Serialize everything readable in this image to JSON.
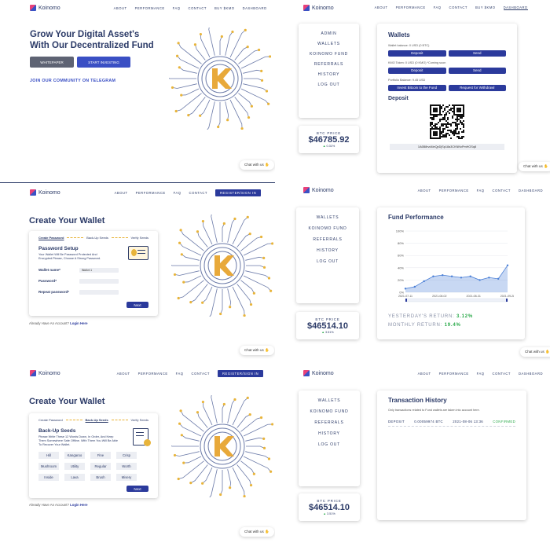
{
  "brand": {
    "name": "Koinomo"
  },
  "nav": {
    "about": "ABOUT",
    "performance": "PERFORMANCE",
    "faq": "FAQ",
    "contact": "CONTACT",
    "buy": "BUY $KMO",
    "dashboard": "DASHBOARD",
    "register": "REGISTER/SIGN IN"
  },
  "landing": {
    "headline_1": "Grow Your Digital Asset's",
    "headline_2": "With Our Decentralized Fund",
    "whitepaper": "WHITEPAPER",
    "start": "START INVESTING",
    "telegram": "JOIN OUR COMMUNITY ON TELEGRAM"
  },
  "menu": {
    "admin": "ADMIN",
    "wallets": "WALLETS",
    "fund": "KOINOMO FUND",
    "referrals": "REFERRALS",
    "history": "HISTORY",
    "logout": "LOG OUT"
  },
  "btc": {
    "label": "BTC PRICE",
    "price_1": "$46785.92",
    "change_1": "0.31%",
    "price_2": "$46514.10",
    "change_2": "3.51%",
    "price_3": "$46514.10",
    "change_3": "3.51%"
  },
  "wallets": {
    "title": "Wallets",
    "btc_balance": "Wallet balance: 0 USD (0 BTC)",
    "deposit": "Deposit",
    "send": "Send",
    "kmo_balance": "KMO Token: 0 USD (0 KMO) *Coming soon",
    "portfolio": "Portfolio Balance: 9.45 USD",
    "invest": "Invest Bitcoin to the Fund",
    "withdraw": "Request for Withdrawl",
    "deposit_title": "Deposit",
    "address": "1A6B8rvd4ieQpDjSp18a3CKNNxPmHGSq8"
  },
  "chat": {
    "label": "Chat with us"
  },
  "create": {
    "title": "Create Your Wallet",
    "step1": "Create Password",
    "step2": "Back-Up Seeds",
    "step3": "Verify Seeds",
    "setup_title": "Password Setup",
    "setup_desc": "Your Wallet Will Be Password Protected And Encrypted.Please, Choose A Strong Password.",
    "wallet_name": "Wallet name*",
    "wallet_value": "Wallet 1",
    "password": "Password*",
    "repeat": "Repeat password*",
    "next": "Next",
    "have_account": "Already Have An Account?",
    "login": "Login Here",
    "seeds_title": "Back-Up Seeds",
    "seeds_desc": "Please Write These 12 Words Down, In Order, And Keep Them Somewhere Safe Offline. With Them You Will Be Able To Recover Your Wallet.",
    "seeds": [
      "Hill",
      "Kangaroo",
      "Fine",
      "Crisp",
      "Mushroom",
      "Utility",
      "Regular",
      "Worth",
      "Inside",
      "Lava",
      "Brush",
      "Misery"
    ]
  },
  "fund": {
    "title": "Fund Performance",
    "yesterday_label": "YESTERDAY'S RETURN:",
    "yesterday_value": "3.12%",
    "monthly_label": "MONTHLY RETURN:",
    "monthly_value": "19.4%"
  },
  "history": {
    "title": "Transaction History",
    "note": "Only transactions related to Fund wallets are taken into account here.",
    "type": "DEPOSIT",
    "amount": "0.00059974 BTC",
    "date": "2021-08-06 13:36",
    "status": "CONFIRMED"
  },
  "chart_data": {
    "type": "area",
    "x": [
      "2021-07-11",
      "2021-07-18",
      "2021-07-25",
      "2021-08-02",
      "2021-08-09",
      "2021-08-16",
      "2021-08-23",
      "2021-08-31",
      "2021-09-07",
      "2021-09-14",
      "2021-09-21",
      "2021-09-28"
    ],
    "x_ticks": [
      "2021-07-11",
      "2021-08-02",
      "2021-08-31",
      "2021-09-28"
    ],
    "y_ticks": [
      "0%",
      "20%",
      "40%",
      "60%",
      "80%",
      "100%"
    ],
    "ylim": [
      0,
      100
    ],
    "series": [
      {
        "values": [
          6,
          9,
          18,
          26,
          28,
          26,
          24,
          26,
          20,
          24,
          22,
          44
        ]
      }
    ],
    "grid": true,
    "color": "#4a7fd6"
  },
  "colors": {
    "navy": "#2b3a67",
    "brand_blue": "#3a4fc4",
    "gold": "#e8b43a",
    "green": "#2aaa4a"
  }
}
